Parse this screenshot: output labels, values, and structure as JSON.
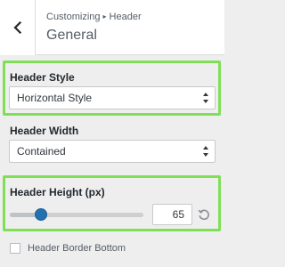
{
  "header": {
    "breadcrumb": "Customizing",
    "breadcrumb_separator": "▸",
    "breadcrumb_current": "Header",
    "title": "General",
    "back_icon": "chevron-left-icon"
  },
  "highlight_color": "#7fe056",
  "accent_color": "#2271b1",
  "controls": {
    "header_style": {
      "label": "Header Style",
      "selected": "Horizontal Style"
    },
    "header_width": {
      "label": "Header Width",
      "selected": "Contained"
    },
    "header_height": {
      "label": "Header Height (px)",
      "value": "65",
      "slider_fraction": 0.23,
      "reset_icon": "reset-icon"
    },
    "header_border_bottom": {
      "label": "Header Border Bottom",
      "checked": false
    }
  }
}
